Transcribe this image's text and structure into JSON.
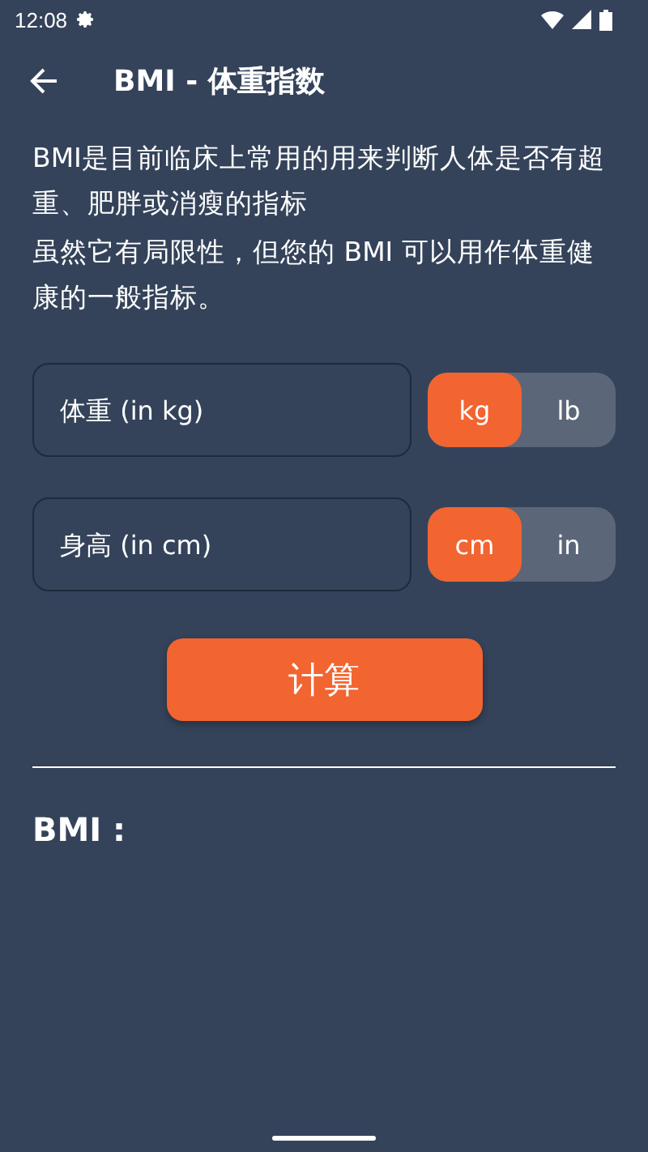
{
  "status_bar": {
    "time": "12:08"
  },
  "header": {
    "title": "BMI - 体重指数"
  },
  "intro": [
    "BMI是目前临床上常用的用来判断人体是否有超重、肥胖或消瘦的指标",
    "虽然它有局限性，但您的 BMI 可以用作体重健康的一般指标。"
  ],
  "inputs": [
    {
      "placeholder": "体重 (in kg)",
      "units": [
        {
          "label": "kg",
          "selected": true
        },
        {
          "label": "lb",
          "selected": false
        }
      ]
    },
    {
      "placeholder": "身高 (in cm)",
      "units": [
        {
          "label": "cm",
          "selected": true
        },
        {
          "label": "in",
          "selected": false
        }
      ]
    }
  ],
  "button": "计算",
  "result": {
    "label": "BMI :"
  }
}
